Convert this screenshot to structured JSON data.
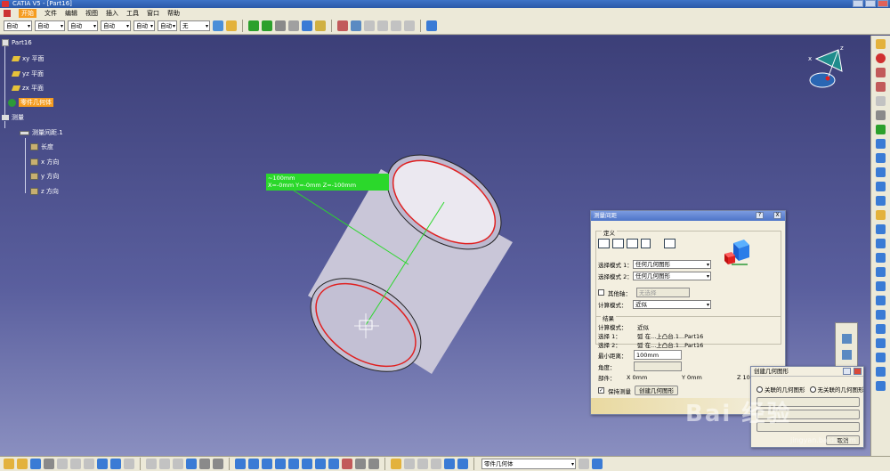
{
  "window": {
    "title": "CATIA V5 - [Part16]"
  },
  "menu": [
    "开始",
    "文件",
    "编辑",
    "视图",
    "插入",
    "工具",
    "窗口",
    "帮助"
  ],
  "toolbar": {
    "selects": [
      "自动",
      "自动",
      "自动",
      "自动",
      "自动",
      "自动",
      "无"
    ]
  },
  "tree": {
    "root": "Part16",
    "planes": [
      "xy 平面",
      "yz 平面",
      "zx 平面"
    ],
    "body": "零件几何体",
    "measure": "测量",
    "measure_item": "测量间距.1",
    "measure_children": [
      "长度",
      "x 方向",
      "y 方向",
      "z 方向"
    ]
  },
  "green_label": {
    "line1": "~100mm",
    "line2": "X=-0mm  Y=-0mm  Z=-100mm"
  },
  "dialog": {
    "title": "测量间距",
    "help": "?",
    "close": "X",
    "definition_label": "定义",
    "mode1_label": "选择模式 1：",
    "mode1_value": "任何几何图形",
    "mode2_label": "选择模式 2：",
    "mode2_value": "任何几何图形",
    "other_axis_label": "其他轴：",
    "other_axis_value": "无选择",
    "calc_mode_label": "计算模式：",
    "calc_mode_value": "近似",
    "result_label": "结果",
    "res_calc_label": "计算模式：",
    "res_calc_value": "近似",
    "sel1_label": "选择 1：",
    "sel1_value": "弧 在...上凸台.1...Part16",
    "sel2_label": "选择 2：",
    "sel2_value": "弧 在...上凸台.1...Part16",
    "min_dist_label": "最小距离：",
    "min_dist_value": "100mm",
    "angle_label": "角度：",
    "component_label": "部件：",
    "x_value": "X 0mm",
    "y_value": "Y 0mm",
    "z_value": "Z 100mm",
    "keep_label": "保持测量",
    "create_geo_btn": "创建几何图形"
  },
  "dialog2": {
    "title": "创建几何图形",
    "opt1": "关联的几何图形",
    "opt2": "无关联的几何图形",
    "btn_cancel": "取消",
    "btn_point": "点"
  },
  "compass": {
    "x": "x",
    "z": "z"
  },
  "bottom": {
    "body_select": "零件几何体"
  },
  "watermark": {
    "text": "Bai 经验",
    "url": "jingyan.baidu.com"
  },
  "colors": {
    "orange": "#f59c20",
    "green": "#2bd82b",
    "red": "#e02020"
  }
}
